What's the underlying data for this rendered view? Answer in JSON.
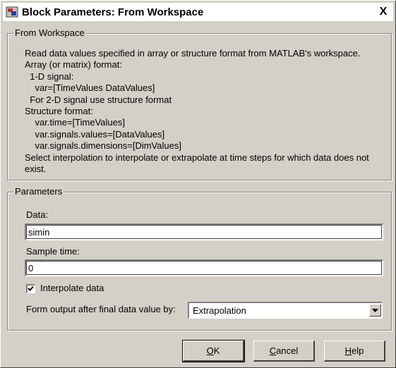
{
  "window": {
    "title": "Block Parameters: From Workspace",
    "close_glyph": "X"
  },
  "from_workspace": {
    "legend": "From Workspace",
    "lines": [
      "Read data values specified in array or structure format from MATLAB's workspace.",
      "Array (or matrix) format:",
      "  1-D signal:",
      "    var=[TimeValues DataValues]",
      "  For 2-D signal use structure format",
      "Structure format:",
      "    var.time=[TimeValues]",
      "    var.signals.values=[DataValues]",
      "    var.signals.dimensions=[DimValues]",
      "Select interpolation to interpolate or extrapolate at time steps for which data does not",
      "exist."
    ]
  },
  "parameters": {
    "legend": "Parameters",
    "data_label": "Data:",
    "data_value": "simin",
    "sample_time_label": "Sample time:",
    "sample_time_value": "0",
    "interpolate_label": "Interpolate data",
    "interpolate_checked": true,
    "form_output_label": "Form output after final data value by:",
    "form_output_value": "Extrapolation"
  },
  "buttons": {
    "ok": {
      "access_key": "O",
      "rest": "K"
    },
    "cancel": {
      "access_key": "C",
      "rest": "ancel"
    },
    "help": {
      "access_key": "H",
      "rest": "elp"
    }
  },
  "icons": {
    "app": "simulink-block-icon",
    "close": "close-icon",
    "check": "checkmark-icon",
    "dropdown": "chevron-down-icon"
  }
}
